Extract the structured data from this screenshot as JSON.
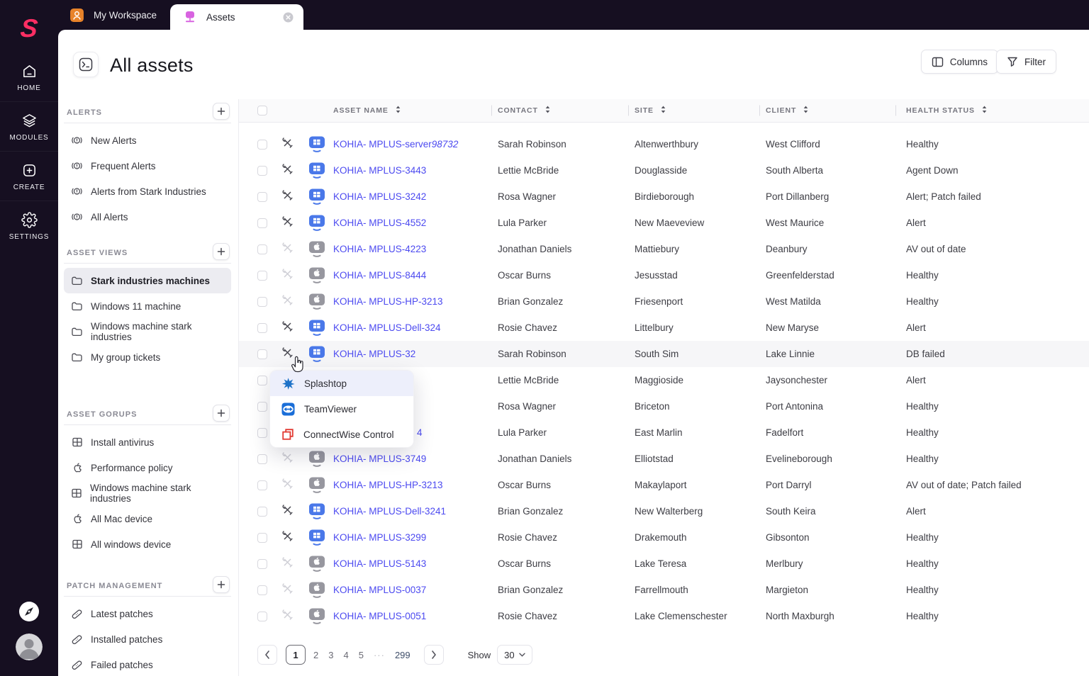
{
  "colors": {
    "accent": "#fd2e63",
    "link": "#4c4af0",
    "windows_icon": "#4a78e9",
    "mac_icon": "#97979f",
    "menu_highlight": "#edeffb"
  },
  "rail": {
    "items": [
      {
        "label": "HOME",
        "icon": "home"
      },
      {
        "label": "MODULES",
        "icon": "modules"
      },
      {
        "label": "CREATE",
        "icon": "create"
      },
      {
        "label": "SETTINGS",
        "icon": "settings"
      }
    ]
  },
  "tabbar": {
    "workspace_tab": "My Workspace",
    "assets_tab": "Assets"
  },
  "page_header": {
    "title": "All assets",
    "columns_button": "Columns",
    "filter_button": "Filter"
  },
  "sidebar": {
    "sections": [
      {
        "title": "ALERTS",
        "items": [
          {
            "label": "New Alerts",
            "icon": "alert"
          },
          {
            "label": "Frequent Alerts",
            "icon": "alert"
          },
          {
            "label": "Alerts from Stark Industries",
            "icon": "alert"
          },
          {
            "label": "All Alerts",
            "icon": "alert"
          }
        ]
      },
      {
        "title": "ASSET VIEWS",
        "items": [
          {
            "label": "Stark industries machines",
            "icon": "folder",
            "selected": true
          },
          {
            "label": "Windows 11 machine",
            "icon": "folder"
          },
          {
            "label": "Windows machine stark industries",
            "icon": "folder"
          },
          {
            "label": "My group tickets",
            "icon": "folder"
          }
        ]
      },
      {
        "title": "ASSET GORUPS",
        "items": [
          {
            "label": "Install antivirus",
            "icon": "windows"
          },
          {
            "label": "Performance policy",
            "icon": "apple"
          },
          {
            "label": "Windows machine stark industries",
            "icon": "windows"
          },
          {
            "label": "All Mac device",
            "icon": "apple"
          },
          {
            "label": "All windows device",
            "icon": "windows"
          }
        ]
      },
      {
        "title": "PATCH MANAGEMENT",
        "items": [
          {
            "label": "Latest patches",
            "icon": "patch"
          },
          {
            "label": "Installed patches",
            "icon": "patch"
          },
          {
            "label": "Failed patches",
            "icon": "patch"
          }
        ]
      }
    ]
  },
  "table": {
    "columns": [
      "ASSET NAME",
      "CONTACT",
      "SITE",
      "CLIENT",
      "HEALTH STATUS"
    ],
    "rows": [
      {
        "name": "KOHIA- MPLUS-server",
        "name_italic": "98732",
        "os": "windows",
        "online": true,
        "contact": "Sarah Robinson",
        "site": "Altenwerthbury",
        "client": "West Clifford",
        "health": "Healthy"
      },
      {
        "name": "KOHIA- MPLUS-3443",
        "os": "windows",
        "online": true,
        "contact": "Lettie McBride",
        "site": "Douglasside",
        "client": "South Alberta",
        "health": "Agent Down"
      },
      {
        "name": "KOHIA- MPLUS-3242",
        "os": "windows",
        "online": true,
        "contact": "Rosa Wagner",
        "site": "Birdieborough",
        "client": "Port Dillanberg",
        "health": "Alert; Patch failed"
      },
      {
        "name": "KOHIA- MPLUS-4552",
        "os": "windows",
        "online": true,
        "contact": "Lula Parker",
        "site": "New Maeveview",
        "client": "West Maurice",
        "health": "Alert"
      },
      {
        "name": "KOHIA- MPLUS-4223",
        "os": "mac",
        "online": false,
        "contact": "Jonathan Daniels",
        "site": "Mattiebury",
        "client": "Deanbury",
        "health": "AV out of date"
      },
      {
        "name": "KOHIA- MPLUS-8444",
        "os": "mac",
        "online": false,
        "contact": "Oscar Burns",
        "site": "Jesusstad",
        "client": "Greenfelderstad",
        "health": "Healthy"
      },
      {
        "name": "KOHIA- MPLUS-HP-3213",
        "os": "mac",
        "online": false,
        "contact": "Brian Gonzalez",
        "site": "Friesenport",
        "client": "West Matilda",
        "health": "Healthy"
      },
      {
        "name": "KOHIA- MPLUS-Dell-324",
        "os": "windows",
        "online": true,
        "contact": "Rosie Chavez",
        "site": "Littelbury",
        "client": "New Maryse",
        "health": "Alert"
      },
      {
        "name": "KOHIA- MPLUS-32",
        "os": "windows",
        "online": true,
        "hovered": true,
        "contact": "Sarah Robinson",
        "site": "South Sim",
        "client": "Lake Linnie",
        "health": "DB failed"
      },
      {
        "name": "",
        "covered": true,
        "contact": "Lettie McBride",
        "site": "Maggioside",
        "client": "Jaysonchester",
        "health": "Alert"
      },
      {
        "name": "",
        "covered": true,
        "contact": "Rosa Wagner",
        "site": "Briceton",
        "client": "Port Antonina",
        "health": "Healthy"
      },
      {
        "name": "4",
        "covered": true,
        "name_offset": true,
        "contact": "Lula Parker",
        "site": "East Marlin",
        "client": "Fadelfort",
        "health": "Healthy"
      },
      {
        "name": "KOHIA- MPLUS-3749",
        "os": "mac",
        "online": false,
        "contact": "Jonathan Daniels",
        "site": "Elliotstad",
        "client": "Evelineborough",
        "health": "Healthy"
      },
      {
        "name": "KOHIA- MPLUS-HP-3213",
        "os": "mac",
        "online": false,
        "contact": "Oscar Burns",
        "site": "Makaylaport",
        "client": "Port Darryl",
        "health": "AV out of date; Patch failed"
      },
      {
        "name": "KOHIA- MPLUS-Dell-3241",
        "os": "windows",
        "online": true,
        "contact": "Brian Gonzalez",
        "site": "New Walterberg",
        "client": "South Keira",
        "health": "Alert"
      },
      {
        "name": "KOHIA- MPLUS-3299",
        "os": "windows",
        "online": true,
        "contact": "Rosie Chavez",
        "site": "Drakemouth",
        "client": "Gibsonton",
        "health": "Healthy"
      },
      {
        "name": "KOHIA- MPLUS-5143",
        "os": "mac",
        "online": false,
        "contact": "Oscar Burns",
        "site": "Lake Teresa",
        "client": "Merlbury",
        "health": "Healthy"
      },
      {
        "name": "KOHIA- MPLUS-0037",
        "os": "mac",
        "online": false,
        "contact": "Brian Gonzalez",
        "site": "Farrellmouth",
        "client": "Margieton",
        "health": "Healthy"
      },
      {
        "name": "KOHIA- MPLUS-0051",
        "os": "mac",
        "online": false,
        "contact": "Rosie Chavez",
        "site": "Lake Clemenschester",
        "client": "North Maxburgh",
        "health": "Healthy"
      }
    ]
  },
  "remote_menu": {
    "items": [
      {
        "label": "Splashtop",
        "icon": "splashtop",
        "highlighted": true
      },
      {
        "label": "TeamViewer",
        "icon": "teamviewer"
      },
      {
        "label": "ConnectWise Control",
        "icon": "connectwise"
      }
    ]
  },
  "pagination": {
    "pages": [
      "1",
      "2",
      "3",
      "4",
      "5",
      "···",
      "299"
    ],
    "active_page": "1",
    "show_label": "Show",
    "page_size": "30"
  }
}
